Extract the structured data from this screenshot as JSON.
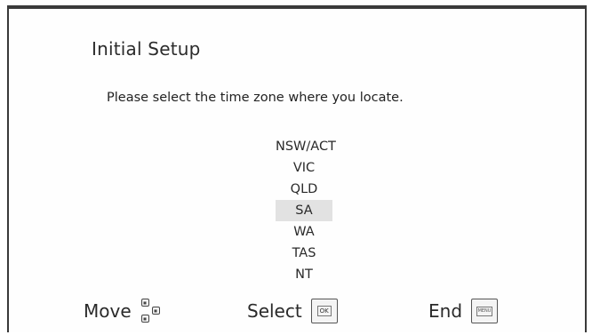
{
  "screen": {
    "title": "Initial Setup",
    "instruction": "Please select the time zone where you locate."
  },
  "time_zones": {
    "items": [
      {
        "label": "NSW/ACT",
        "selected": false
      },
      {
        "label": "VIC",
        "selected": false
      },
      {
        "label": "QLD",
        "selected": false
      },
      {
        "label": "SA",
        "selected": true
      },
      {
        "label": "WA",
        "selected": false
      },
      {
        "label": "TAS",
        "selected": false
      },
      {
        "label": "NT",
        "selected": false
      }
    ],
    "selected_value": "SA"
  },
  "footer": {
    "move_label": "Move",
    "select_label": "Select",
    "end_label": "End",
    "ok_key_label": "OK",
    "menu_key_label": "MENU"
  },
  "icons": {
    "move": "dpad-arrows-icon",
    "select": "ok-key-icon",
    "end": "menu-key-icon"
  },
  "colors": {
    "highlight": "#e2e2e2",
    "text": "#2a2a2a",
    "frame": "#3a3a3a"
  }
}
